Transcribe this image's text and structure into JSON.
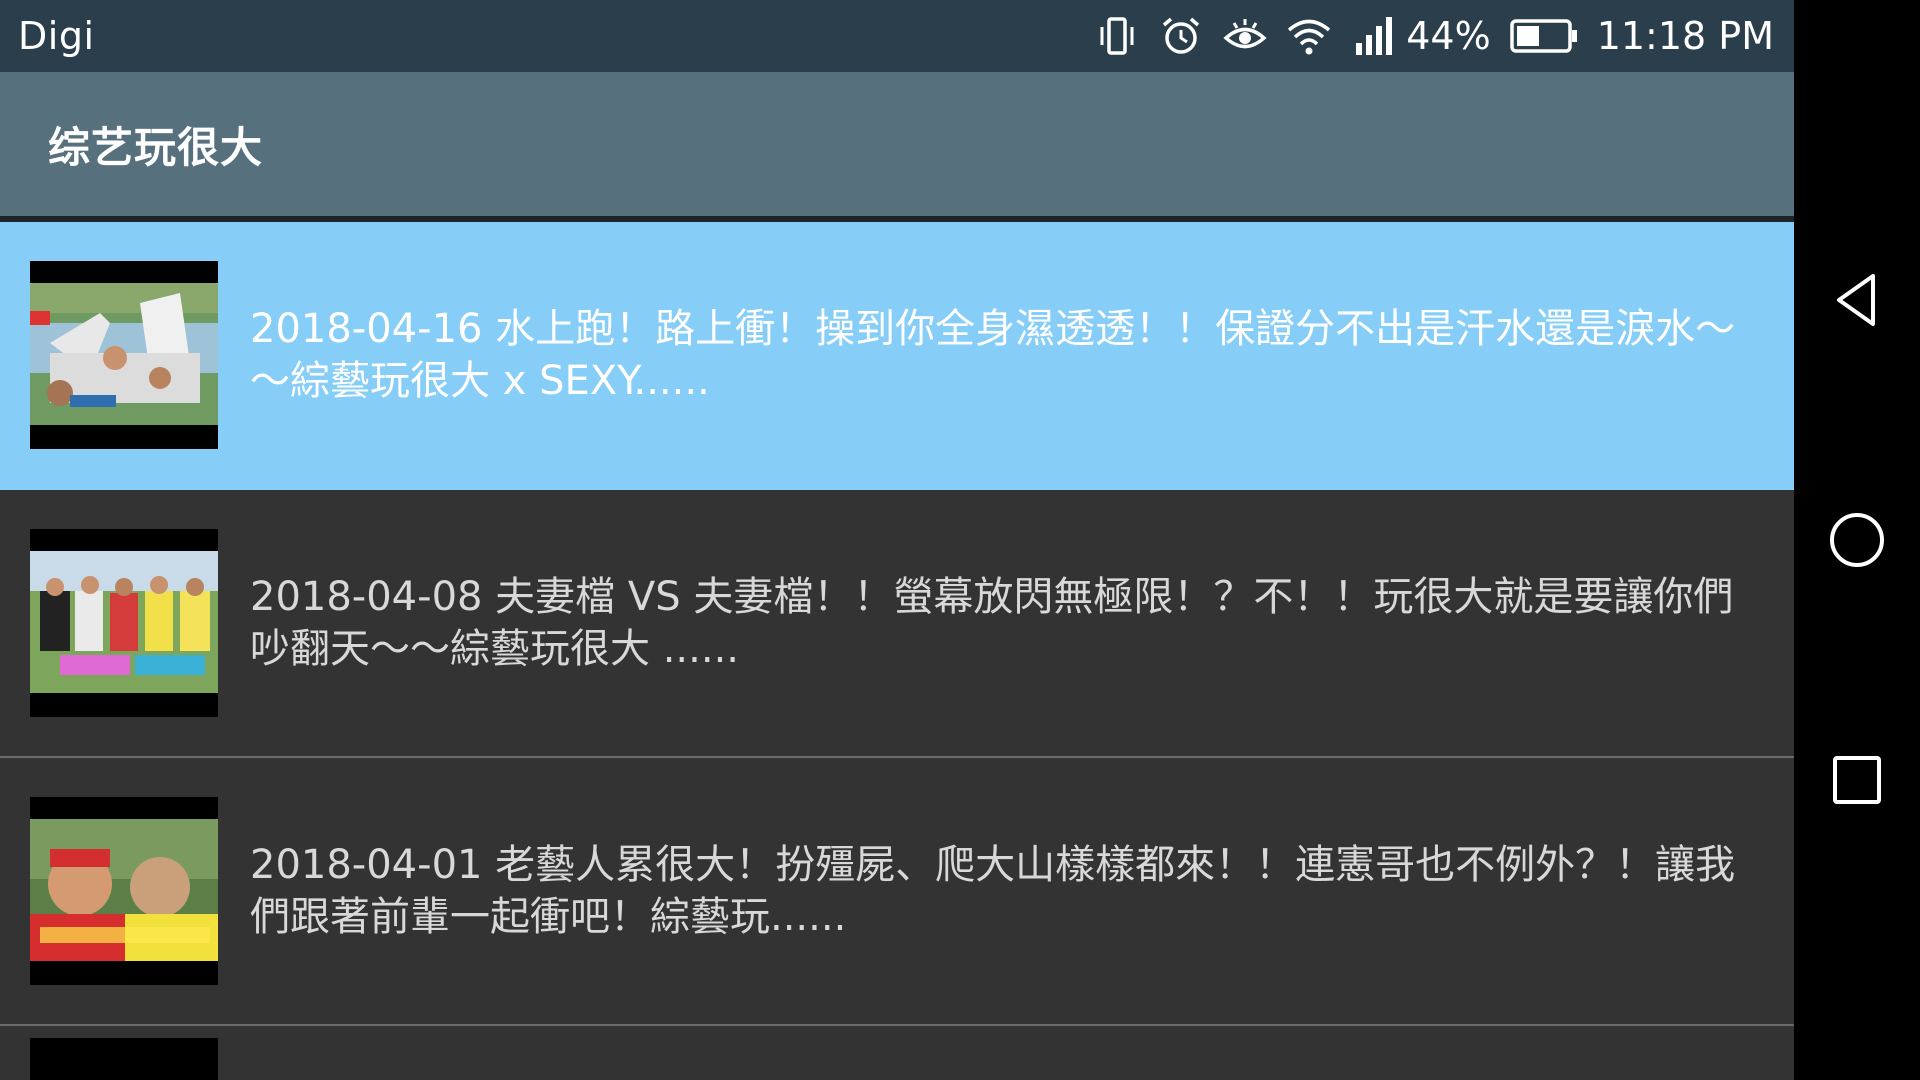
{
  "status_bar": {
    "carrier": "Digi",
    "battery_percent": "44%",
    "time": "11:18 PM",
    "icons": [
      "vibrate-icon",
      "alarm-icon",
      "eye-comfort-icon",
      "wifi-icon",
      "signal-icon",
      "battery-icon"
    ]
  },
  "app_bar": {
    "title": "综艺玩很大"
  },
  "videos": [
    {
      "title": "2018-04-16 水上跑！路上衝！操到你全身濕透透！！保證分不出是汗水還是淚水～～綜藝玩很大 x SEXY......",
      "selected": true
    },
    {
      "title": "2018-04-08 夫妻檔 VS 夫妻檔！！螢幕放閃無極限！？不！！玩很大就是要讓你們吵翻天～～綜藝玩很大 ......",
      "selected": false
    },
    {
      "title": "2018-04-01 老藝人累很大！扮殭屍、爬大山樣樣都來！！連憲哥也不例外？！讓我們跟著前輩一起衝吧！綜藝玩......",
      "selected": false
    }
  ],
  "nav_bar": {
    "buttons": [
      "back-icon",
      "home-icon",
      "recent-apps-icon"
    ]
  },
  "colors": {
    "status_bar_bg": "#2b3e4b",
    "app_bar_bg": "#56707d",
    "list_bg": "#333333",
    "selected_bg": "#86cdf8",
    "nav_bar_bg": "#000000"
  }
}
